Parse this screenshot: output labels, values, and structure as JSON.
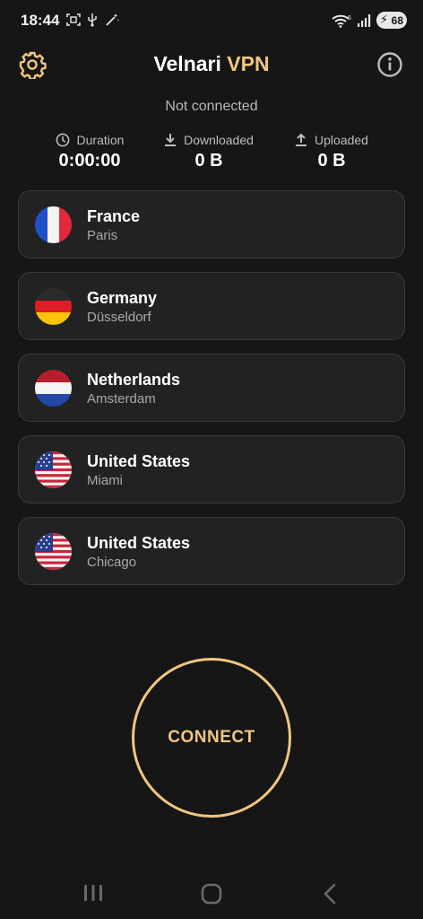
{
  "status_bar": {
    "time": "18:44",
    "battery": "68",
    "left_icons": [
      "screenshot-icon",
      "usb-icon",
      "magic-wand-icon"
    ],
    "right_icons": [
      "wifi-icon",
      "signal-icon",
      "battery-icon"
    ]
  },
  "header": {
    "title_main": "Velnari",
    "title_accent": "VPN",
    "settings_icon": "gear-icon",
    "info_icon": "info-icon"
  },
  "connection": {
    "status": "Not connected"
  },
  "stats": {
    "duration_label": "Duration",
    "duration_value": "0:00:00",
    "downloaded_label": "Downloaded",
    "downloaded_value": "0 B",
    "uploaded_label": "Uploaded",
    "uploaded_value": "0 B"
  },
  "servers": [
    {
      "country": "France",
      "city": "Paris",
      "flag": "france-flag-icon"
    },
    {
      "country": "Germany",
      "city": "Düsseldorf",
      "flag": "germany-flag-icon"
    },
    {
      "country": "Netherlands",
      "city": "Amsterdam",
      "flag": "netherlands-flag-icon"
    },
    {
      "country": "United States",
      "city": "Miami",
      "flag": "usa-flag-icon"
    },
    {
      "country": "United States",
      "city": "Chicago",
      "flag": "usa-flag-icon"
    }
  ],
  "connect_button": {
    "label": "CONNECT"
  },
  "colors": {
    "background": "#161616",
    "card": "#222222",
    "accent": "#f0c680"
  }
}
